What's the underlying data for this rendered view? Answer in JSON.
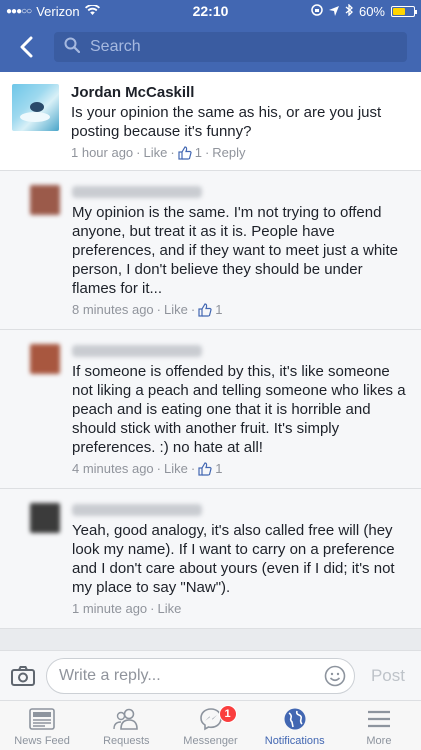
{
  "status_bar": {
    "carrier": "Verizon",
    "time": "22:10",
    "battery": "60%",
    "battery_level": 0.6
  },
  "nav": {
    "search_placeholder": "Search"
  },
  "parent_comment": {
    "author": "Jordan McCaskill",
    "text": "Is your opinion the same as his, or are you just posting because  it's funny?",
    "time": "1 hour ago",
    "like_label": "Like",
    "like_count": "1",
    "reply_label": "Reply"
  },
  "replies": [
    {
      "text": "My opinion is the same. I'm not trying to offend anyone, but treat it as it is. People have preferences, and if they want to meet just a white person, I don't believe they should be under flames for it...",
      "time": "8 minutes ago",
      "like_label": "Like",
      "like_count": "1",
      "avatar_color": "#9b5a4a"
    },
    {
      "text": "If someone is offended by this, it's like someone not liking a peach and telling someone who likes a peach and is eating one that it is horrible and should stick with another fruit. It's simply preferences. :) no hate at all!",
      "time": "4 minutes ago",
      "like_label": "Like",
      "like_count": "1",
      "avatar_color": "#a8573f"
    },
    {
      "text": "Yeah, good analogy, it's also called free will (hey look my name). If I want to carry on a preference and I don't care about yours (even if I did; it's not my place to say \"Naw\").",
      "time": "1 minute ago",
      "like_label": "Like",
      "like_count": "",
      "avatar_color": "#3b3b3b"
    }
  ],
  "composer": {
    "placeholder": "Write a reply...",
    "post_label": "Post"
  },
  "tabs": [
    {
      "label": "News Feed",
      "icon": "news-feed-icon"
    },
    {
      "label": "Requests",
      "icon": "requests-icon"
    },
    {
      "label": "Messenger",
      "icon": "messenger-icon",
      "badge": "1"
    },
    {
      "label": "Notifications",
      "icon": "notifications-globe-icon",
      "active": true
    },
    {
      "label": "More",
      "icon": "more-menu-icon"
    }
  ],
  "colors": {
    "brand_blue": "#4267b2",
    "badge_red": "#fa3e3e",
    "battery_yellow": "#ffd400"
  }
}
